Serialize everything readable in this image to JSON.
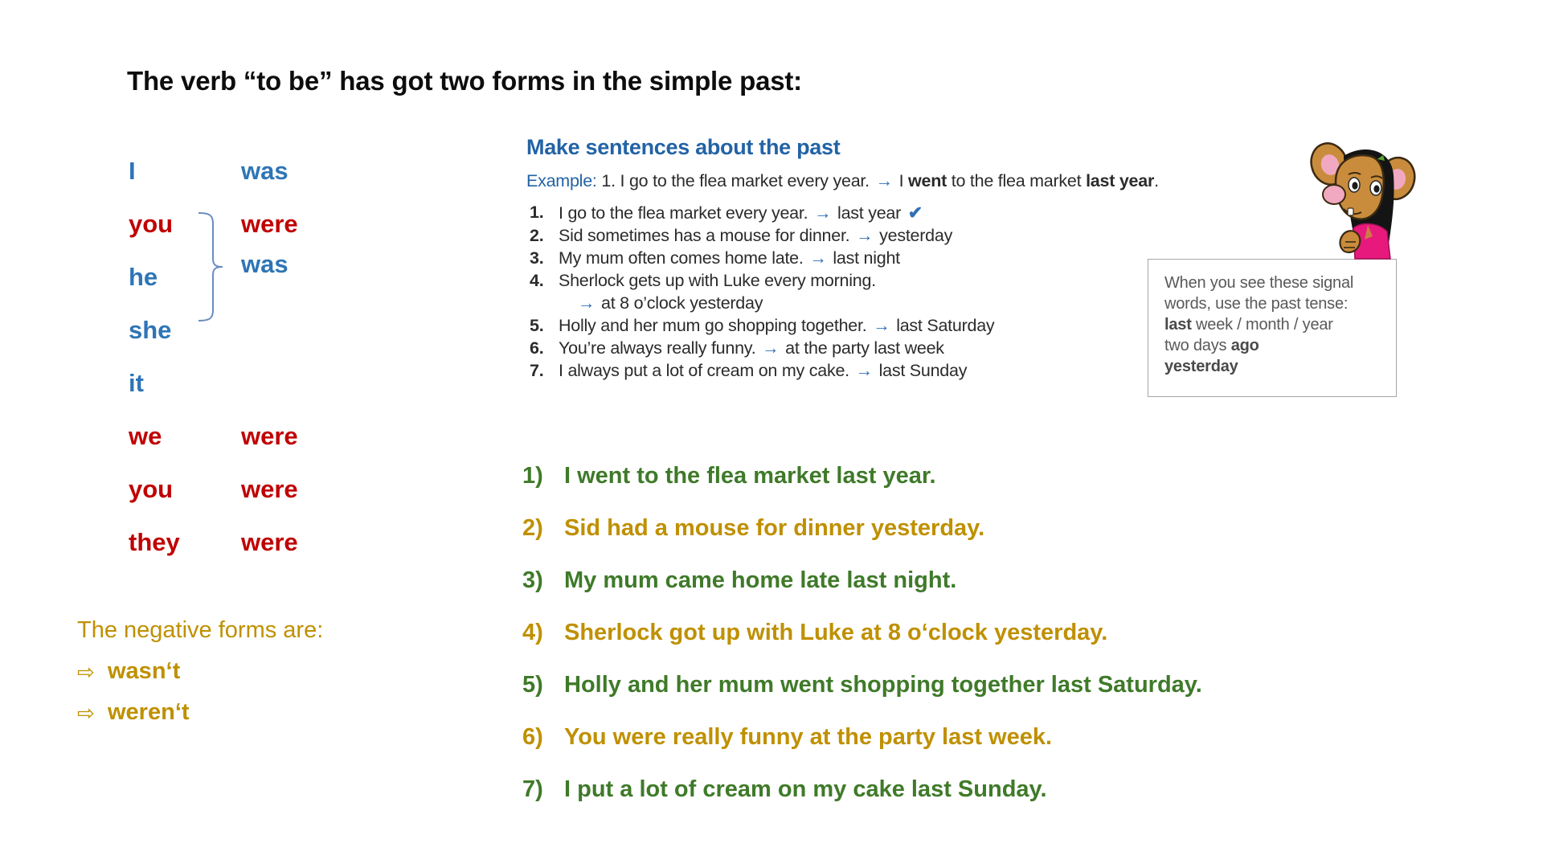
{
  "title": "The verb “to be” has got two forms in the simple past:",
  "colors": {
    "blue": "#2E75B6",
    "red": "#C00000",
    "green": "#3F7A29",
    "gold": "#BF9000",
    "worksheet_blue": "#2263A5",
    "box_gray": "#595959"
  },
  "conjugation": {
    "rows": [
      {
        "pronoun": "I",
        "verb": "was",
        "color": "blue",
        "grouped": false
      },
      {
        "pronoun": "you",
        "verb": "were",
        "color": "red",
        "grouped": false
      },
      {
        "pronoun": "he",
        "verb": "",
        "color": "blue",
        "grouped": true
      },
      {
        "pronoun": "she",
        "verb": "",
        "color": "blue",
        "grouped": true
      },
      {
        "pronoun": "it",
        "verb": "",
        "color": "blue",
        "grouped": true
      },
      {
        "pronoun": "we",
        "verb": "were",
        "color": "red",
        "grouped": false
      },
      {
        "pronoun": "you",
        "verb": "were",
        "color": "red",
        "grouped": false
      },
      {
        "pronoun": "they",
        "verb": "were",
        "color": "red",
        "grouped": false
      }
    ],
    "group_verb": "was"
  },
  "negatives": {
    "heading": "The negative forms are:",
    "items": [
      {
        "arrow": "⇨",
        "text": "wasn‘t"
      },
      {
        "arrow": "⇨",
        "text": "weren‘t"
      }
    ]
  },
  "worksheet": {
    "heading": "Make sentences about the past",
    "example": {
      "label": "Example:",
      "number": "1.",
      "prompt": "I go to the flea market every year.",
      "arrow": "→",
      "answer_pre": "I ",
      "answer_bold1": "went",
      "answer_mid": " to the flea market ",
      "answer_bold2": "last year",
      "answer_end": "."
    },
    "items": [
      {
        "num": "1.",
        "sentence": "I go to the flea market every year.",
        "arrow": "→",
        "cue": "last year",
        "check": "✔",
        "wrap": false
      },
      {
        "num": "2.",
        "sentence": "Sid sometimes has a mouse for dinner.",
        "arrow": "→",
        "cue": "yesterday",
        "check": "",
        "wrap": false
      },
      {
        "num": "3.",
        "sentence": "My mum often comes home late.",
        "arrow": "→",
        "cue": "last night",
        "check": "",
        "wrap": false
      },
      {
        "num": "4.",
        "sentence": "Sherlock gets up with Luke every morning.",
        "arrow": "→",
        "cue": "at 8 o’clock yesterday",
        "check": "",
        "wrap": true
      },
      {
        "num": "5.",
        "sentence": "Holly and her mum go shopping together.",
        "arrow": "→",
        "cue": "last Saturday",
        "check": "",
        "wrap": false
      },
      {
        "num": "6.",
        "sentence": "You’re always really funny.",
        "arrow": "→",
        "cue": "at the party last week",
        "check": "",
        "wrap": false
      },
      {
        "num": "7.",
        "sentence": "I always put a lot of cream on my cake.",
        "arrow": "→",
        "cue": "last Sunday",
        "check": "",
        "wrap": false
      }
    ]
  },
  "signal_box": {
    "line1": "When you see these signal",
    "line2": "words, use the past tense:",
    "line3_bold": "last",
    "line3_rest": " week / month / year",
    "line4_pre": "two days ",
    "line4_bold": "ago",
    "line5_bold": "yesterday"
  },
  "mouse": {
    "name": "mouse-mascot",
    "hair_color": "#1a1a1a",
    "face_color": "#C98C3C",
    "ear_inner": "#F0A9C0",
    "shirt_color": "#E8197D"
  },
  "answers": [
    {
      "num": "1)",
      "text": "I went to the flea market last year.",
      "color": "green"
    },
    {
      "num": "2)",
      "text": "Sid had a mouse for dinner yesterday.",
      "color": "gold"
    },
    {
      "num": "3)",
      "text": "My mum came home late last night.",
      "color": "green"
    },
    {
      "num": "4)",
      "text": "Sherlock got up with Luke at 8 o‘clock yesterday.",
      "color": "gold"
    },
    {
      "num": "5)",
      "text": "Holly and her mum went shopping together last Saturday.",
      "color": "green"
    },
    {
      "num": "6)",
      "text": "You were really funny at the party last week.",
      "color": "gold"
    },
    {
      "num": "7)",
      "text": "I put a lot of cream on my cake last Sunday.",
      "color": "green"
    }
  ]
}
